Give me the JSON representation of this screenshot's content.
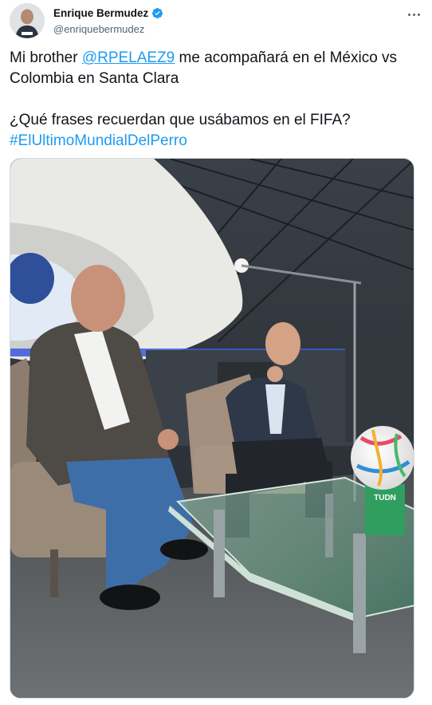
{
  "author": {
    "display_name": "Enrique Bermudez",
    "handle": "@enriquebermudez",
    "verified": true,
    "avatar_icon": "profile-photo"
  },
  "tweet": {
    "line1_prefix": "Mi brother ",
    "mention": "@RPELAEZ9",
    "line1_suffix": " me acompañará en el México vs Colombia en Santa Clara",
    "line2": "¿Qué frases recuerdan que usábamos en el FIFA?",
    "hashtag": "#ElUltimoMundialDelPerro"
  },
  "media": {
    "ball_sticker_text": "TUDN"
  },
  "colors": {
    "link": "#1d9bf0",
    "verified_badge": "#1d9bf0",
    "text": "#0f1419",
    "muted": "#536471"
  }
}
